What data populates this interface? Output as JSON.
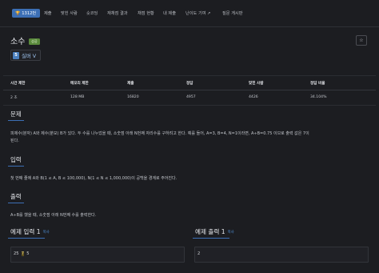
{
  "tabs": [
    {
      "label": "1312번",
      "active": true
    },
    {
      "label": "제출"
    },
    {
      "label": "맞힌 사람"
    },
    {
      "label": "숏코딩"
    },
    {
      "label": "재채점 결과"
    },
    {
      "label": "채점 현황"
    },
    {
      "label": "내 제출"
    },
    {
      "label": "난이도 기여"
    },
    {
      "label": "질문 게시판"
    }
  ],
  "problem": {
    "title": "소수",
    "badge": "성공",
    "tier_icon": "5",
    "tier_label": "실버 V",
    "star_icon": "☆"
  },
  "stats": {
    "headers": [
      "시간 제한",
      "메모리 제한",
      "제출",
      "정답",
      "맞힌 사람",
      "정답 비율"
    ],
    "values": [
      "2 초",
      "128 MB",
      "16820",
      "4957",
      "4426",
      "34.104%"
    ]
  },
  "sections": {
    "problem_title": "문제",
    "problem_text": "피제수(분자) A와 제수(분모) B가 있다. 두 수를 나누었을 때, 소숫점 아래 N번째 자리수를 구하려고 한다. 예를 들어, A=3, B=4, N=1이라면, A÷B=0.75 이므로 출력 값은 7이",
    "problem_text_2": "된다.",
    "input_title": "입력",
    "input_text": "첫 번째 줄에 A와 B(1 ≤ A, B ≤ 100,000), N(1 ≤ N ≤ 1,000,000)이 공백을 경계로 주어진다.",
    "output_title": "출력",
    "output_text": "A÷B를 했을 때, 소숫점 아래 N번째 수를 출력한다."
  },
  "examples": {
    "input_title": "예제 입력 1",
    "output_title": "예제 출력 1",
    "copy_label": "복사",
    "input_parts": [
      "25",
      "7",
      "5"
    ],
    "output_value": "2"
  },
  "colors": {
    "accent": "#3c6fb5",
    "badge_green": "#5a8a3c",
    "tier_silver_blue": "#4a7fbf",
    "highlight": "#5b4e1e"
  }
}
